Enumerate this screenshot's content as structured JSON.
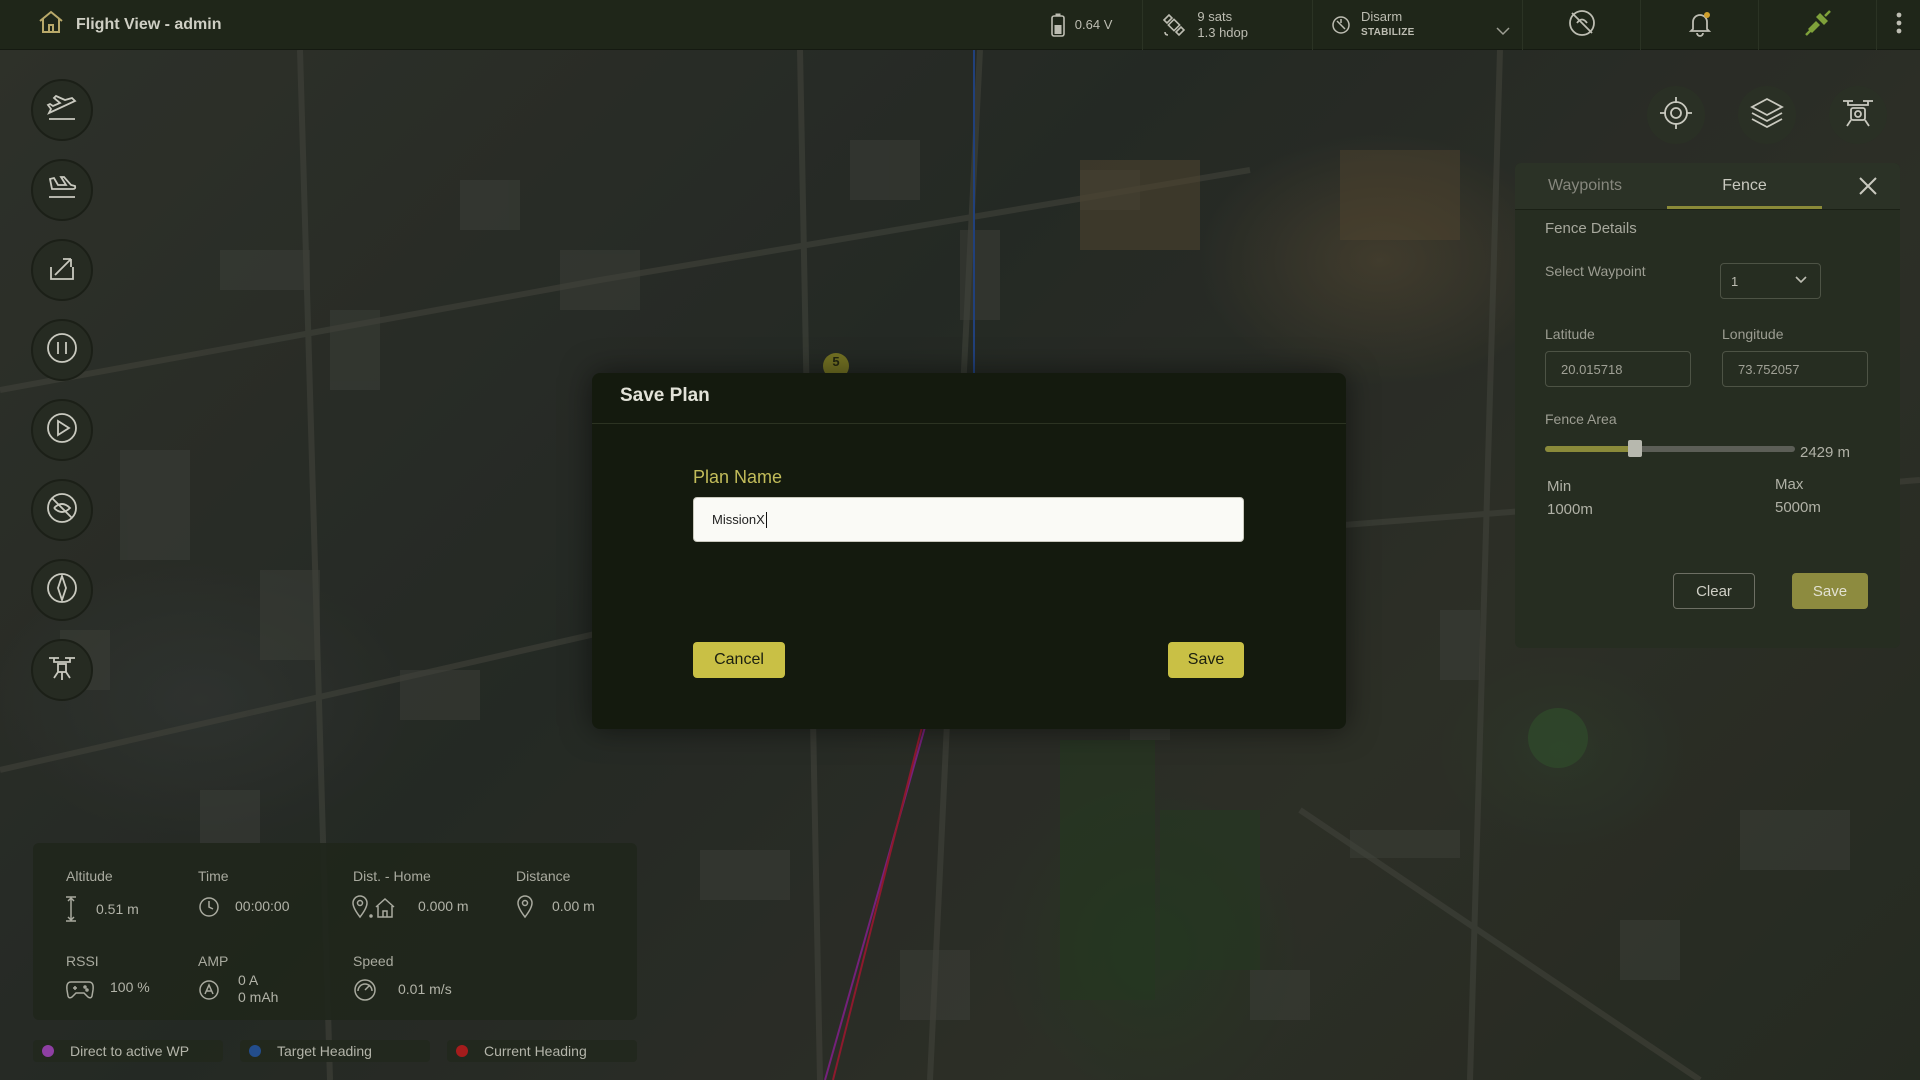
{
  "app": {
    "title": "Flight View - admin"
  },
  "status": {
    "battery": "0.64 V",
    "gps_sats": "9 sats",
    "gps_hdop": "1.3 hdop",
    "arm_state": "Disarm",
    "flight_mode": "STABILIZE"
  },
  "map": {
    "waypoint_marker": "5"
  },
  "panel": {
    "tabs": {
      "waypoints": "Waypoints",
      "fence": "Fence"
    },
    "heading": "Fence Details",
    "select_waypoint_label": "Select Waypoint",
    "select_waypoint_value": "1",
    "latitude_label": "Latitude",
    "latitude_value": "20.015718",
    "longitude_label": "Longitude",
    "longitude_value": "73.752057",
    "fence_area_label": "Fence Area",
    "fence_area_value": "2429 m",
    "fence_area_fraction": 0.36,
    "min_label": "Min",
    "min_value": "1000m",
    "max_label": "Max",
    "max_value": "5000m",
    "clear_label": "Clear",
    "save_label": "Save"
  },
  "modal": {
    "title": "Save Plan",
    "field_label": "Plan Name",
    "field_value": "MissionX",
    "cancel_label": "Cancel",
    "save_label": "Save"
  },
  "telemetry": {
    "altitude_label": "Altitude",
    "altitude_value": "0.51 m",
    "time_label": "Time",
    "time_value": "00:00:00",
    "dist_home_label": "Dist. - Home",
    "dist_home_value": "0.000 m",
    "distance_label": "Distance",
    "distance_value": "0.00 m",
    "rssi_label": "RSSI",
    "rssi_value": "100 %",
    "amp_label": "AMP",
    "amp_value_a": "0 A",
    "amp_value_mah": "0 mAh",
    "speed_label": "Speed",
    "speed_value": "0.01 m/s"
  },
  "legend": [
    {
      "label": "Direct to active WP",
      "color": "#8e3fa3"
    },
    {
      "label": "Target Heading",
      "color": "#234d8c"
    },
    {
      "label": "Current Heading",
      "color": "#a51c1c"
    }
  ],
  "colors": {
    "accent": "#c9c045",
    "panel_save": "#8d8b3f",
    "slider_fill": "#8a8a3a"
  },
  "icons": [
    "home-icon",
    "battery-icon",
    "satellite-icon",
    "mode-icon",
    "chevron-down-icon",
    "no-gps-icon",
    "bell-icon",
    "link-icon",
    "kebab-menu-icon",
    "takeoff-icon",
    "land-icon",
    "rtl-icon",
    "pause-icon",
    "play-icon",
    "no-fly-icon",
    "compass-icon",
    "drone-icon",
    "target-icon",
    "layers-icon",
    "drone-camera-icon",
    "close-icon"
  ]
}
